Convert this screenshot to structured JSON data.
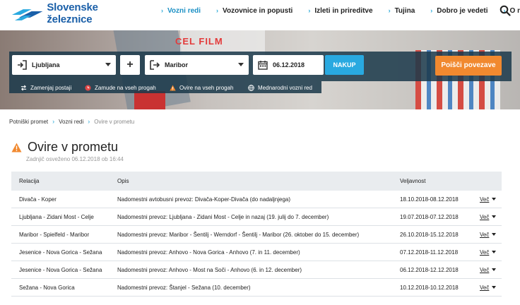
{
  "brand": {
    "name": "Slovenske železnice",
    "color": "#1a5fa8"
  },
  "nav": {
    "items": [
      {
        "label": "Vozni redi",
        "active": true
      },
      {
        "label": "Vozovnice in popusti",
        "active": false
      },
      {
        "label": "Izleti in prireditve",
        "active": false
      },
      {
        "label": "Tujina",
        "active": false
      },
      {
        "label": "Dobro je vedeti",
        "active": false
      },
      {
        "label": "O nas",
        "active": false
      }
    ]
  },
  "hero": {
    "banner_text": "CEL FILM"
  },
  "search": {
    "from": "Ljubljana",
    "add_label": "+",
    "to": "Maribor",
    "date": "06.12.2018",
    "nakup_label": "NAKUP",
    "find_label": "Poišči povezave",
    "options": [
      {
        "label": "Zamenjaj postaji",
        "icon": "swap-icon"
      },
      {
        "label": "Zamude na vseh progah",
        "icon": "clock-icon"
      },
      {
        "label": "Ovire na vseh progah",
        "icon": "warning-icon"
      },
      {
        "label": "Mednarodni vozni red",
        "icon": "globe-icon"
      }
    ]
  },
  "breadcrumb": [
    "Potniški promet",
    "Vozni redi",
    "Ovire v prometu"
  ],
  "page": {
    "title": "Ovire v prometu",
    "updated": "Zadnjič osveženo 06.12.2018 ob 16:44"
  },
  "table": {
    "headers": [
      "Relacija",
      "Opis",
      "Veljavnost",
      ""
    ],
    "more_label": "Več",
    "rows": [
      {
        "relacija": "Divača - Koper",
        "opis": "Nadomestni avtobusni prevoz: Divača-Koper-Divača (do nadaljnjega)",
        "veljavnost": "18.10.2018-08.12.2018"
      },
      {
        "relacija": "Ljubljana - Zidani Most - Celje",
        "opis": "Nadomestni prevoz: Ljubljana - Zidani Most - Celje in nazaj (19. julij do 7. december)",
        "veljavnost": "19.07.2018-07.12.2018"
      },
      {
        "relacija": "Maribor - Spielfeld - Maribor",
        "opis": "Nadomestni prevoz: Maribor - Šentilj - Werndorf - Šentilj - Maribor (26. oktober do 15. december)",
        "veljavnost": "26.10.2018-15.12.2018"
      },
      {
        "relacija": "Jesenice - Nova Gorica - Sežana",
        "opis": "Nadomestni prevoz: Anhovo - Nova Gorica - Anhovo (7. in 11. december)",
        "veljavnost": "07.12.2018-11.12.2018"
      },
      {
        "relacija": "Jesenice - Nova Gorica - Sežana",
        "opis": "Nadomestni prevoz: Anhovo - Most na Soči - Anhovo (6. in 12. december)",
        "veljavnost": "06.12.2018-12.12.2018"
      },
      {
        "relacija": "Sežana - Nova Gorica",
        "opis": "Nadomestni prevoz: Štanjel - Sežana (10. december)",
        "veljavnost": "10.12.2018-10.12.2018"
      }
    ]
  },
  "colors": {
    "accent": "#29a9e0",
    "orange": "#f1892f",
    "panel": "#1b394b",
    "warning": "#f1892f"
  }
}
